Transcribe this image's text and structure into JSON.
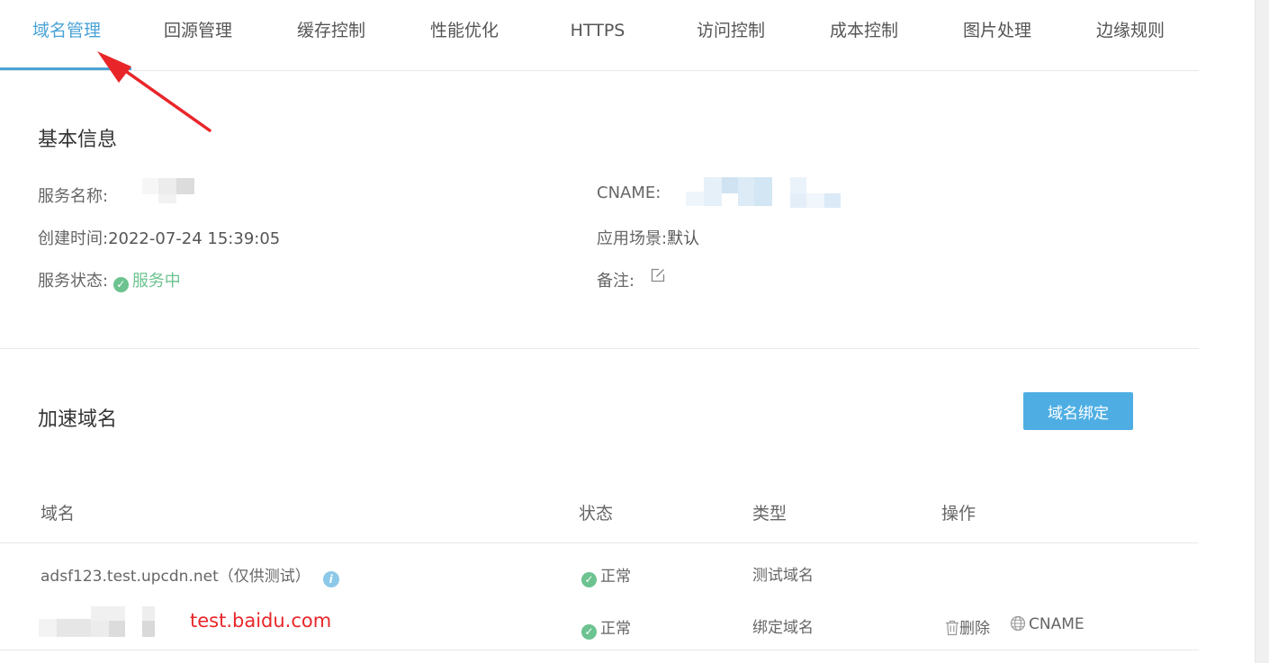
{
  "tabs": [
    {
      "label": "域名管理",
      "active": true
    },
    {
      "label": "回源管理"
    },
    {
      "label": "缓存控制"
    },
    {
      "label": "性能优化"
    },
    {
      "label": "HTTPS"
    },
    {
      "label": "访问控制"
    },
    {
      "label": "成本控制"
    },
    {
      "label": "图片处理"
    },
    {
      "label": "边缘规则"
    }
  ],
  "basic_info": {
    "title": "基本信息",
    "service_name_label": "服务名称:",
    "created_label": "创建时间:",
    "created_value": "2022-07-24 15:39:05",
    "status_label": "服务状态:",
    "status_value": "服务中",
    "cname_label": "CNAME:",
    "scene_label": "应用场景:",
    "scene_value": "默认",
    "remark_label": "备注:"
  },
  "domains": {
    "title": "加速域名",
    "bind_button": "域名绑定",
    "headers": {
      "domain": "域名",
      "status": "状态",
      "type": "类型",
      "action": "操作"
    },
    "rows": [
      {
        "domain": "adsf123.test.upcdn.net（仅供测试）",
        "status": "正常",
        "type": "测试域名"
      },
      {
        "domain_annotation": "test.baidu.com",
        "status": "正常",
        "type": "绑定域名",
        "delete": "删除",
        "cname": "CNAME"
      }
    ]
  },
  "colors": {
    "accent": "#4aa3d8",
    "success": "#6cc38f",
    "annotation": "#e8262a"
  },
  "icons": [
    "check-circle-icon",
    "edit-icon",
    "info-icon",
    "trash-icon",
    "globe-icon",
    "red-arrow"
  ]
}
